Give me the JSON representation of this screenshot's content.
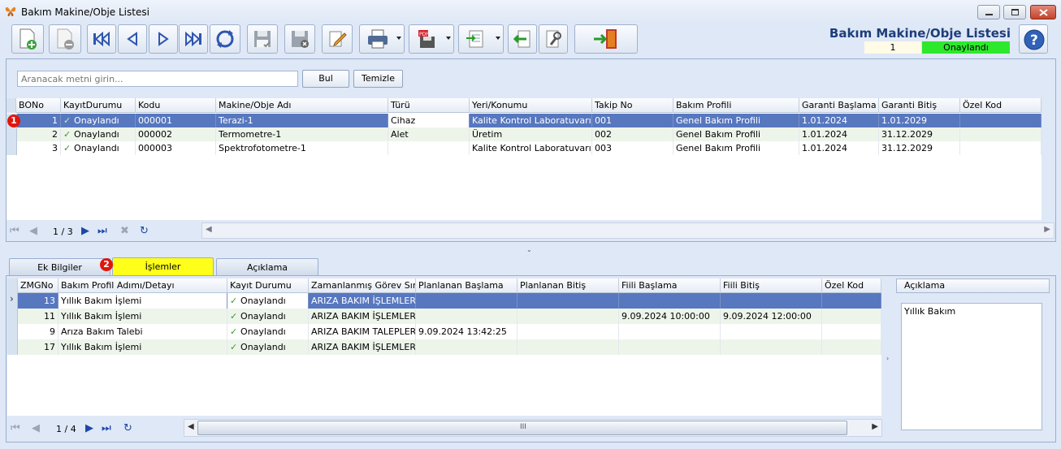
{
  "window": {
    "title": "Bakım Makine/Obje Listesi"
  },
  "toolbar": {
    "buttons": [
      "new-record",
      "delete-record",
      "first-record",
      "previous-record",
      "next-record",
      "last-record",
      "refresh",
      "save",
      "cancel-save",
      "edit",
      "print",
      "export-pdf",
      "import",
      "back",
      "settings",
      "exit"
    ]
  },
  "header": {
    "title": "Bakım Makine/Obje Listesi",
    "record_count": "1",
    "status": "Onaylandı"
  },
  "search": {
    "placeholder": "Aranacak metni girin...",
    "find_label": "Bul",
    "clear_label": "Temizle"
  },
  "main_grid": {
    "columns": [
      "BONo",
      "KayıtDurumu",
      "Kodu",
      "Makine/Obje Adı",
      "Türü",
      "Yeri/Konumu",
      "Takip No",
      "Bakım Profili",
      "Garanti Başlama",
      "Garanti Bitiş",
      "Özel Kod"
    ],
    "rows": [
      {
        "bono": "1",
        "status": "Onaylandı",
        "code": "000001",
        "name": "Terazi-1",
        "type": "Cihaz",
        "location": "Kalite Kontrol Laboratuvarı",
        "tracking": "001",
        "profile": "Genel Bakım Profili",
        "warranty_start": "1.01.2024",
        "warranty_end": "1.01.2029",
        "special": ""
      },
      {
        "bono": "2",
        "status": "Onaylandı",
        "code": "000002",
        "name": "Termometre-1",
        "type": "Alet",
        "location": "Üretim",
        "tracking": "002",
        "profile": "Genel Bakım Profili",
        "warranty_start": "1.01.2024",
        "warranty_end": "31.12.2029",
        "special": ""
      },
      {
        "bono": "3",
        "status": "Onaylandı",
        "code": "000003",
        "name": "Spektrofotometre-1",
        "type": "",
        "location": "Kalite Kontrol Laboratuvarı",
        "tracking": "003",
        "profile": "Genel Bakım Profili",
        "warranty_start": "1.01.2024",
        "warranty_end": "31.12.2029",
        "special": ""
      }
    ],
    "pager": "1 / 3"
  },
  "badges": {
    "one": "1",
    "two": "2"
  },
  "tabs": [
    {
      "label": "Ek Bilgiler"
    },
    {
      "label": "İşlemler"
    },
    {
      "label": "Açıklama"
    }
  ],
  "detail_grid": {
    "columns": [
      "ZMGNo",
      "Bakım Profil Adımı/Detayı",
      "Kayıt Durumu",
      "Zamanlanmış Görev Sınıfı",
      "Planlanan Başlama",
      "Planlanan Bitiş",
      "Fiili Başlama",
      "Fiili Bitiş",
      "Özel Kod"
    ],
    "rows": [
      {
        "no": "13",
        "step": "Yıllık Bakım İşlemi",
        "status": "Onaylandı",
        "class": "ARIZA BAKIM İŞLEMLERİ",
        "plan_start": "",
        "plan_end": "",
        "actual_start": "",
        "actual_end": "",
        "special": ""
      },
      {
        "no": "11",
        "step": "Yıllık Bakım İşlemi",
        "status": "Onaylandı",
        "class": "ARIZA BAKIM İŞLEMLERİ",
        "plan_start": "",
        "plan_end": "",
        "actual_start": "9.09.2024 10:00:00",
        "actual_end": "9.09.2024 12:00:00",
        "special": ""
      },
      {
        "no": "9",
        "step": "Arıza Bakım Talebi",
        "status": "Onaylandı",
        "class": "ARIZA BAKIM TALEPLERİ",
        "plan_start": "9.09.2024 13:42:25",
        "plan_end": "",
        "actual_start": "",
        "actual_end": "",
        "special": ""
      },
      {
        "no": "17",
        "step": "Yıllık Bakım İşlemi",
        "status": "Onaylandı",
        "class": "ARIZA BAKIM İŞLEMLERİ",
        "plan_start": "",
        "plan_end": "",
        "actual_start": "",
        "actual_end": "",
        "special": ""
      }
    ],
    "pager": "1 / 4",
    "scroll_grip": "III"
  },
  "description": {
    "title": "Açıklama",
    "text": "Yıllık Bakım"
  }
}
